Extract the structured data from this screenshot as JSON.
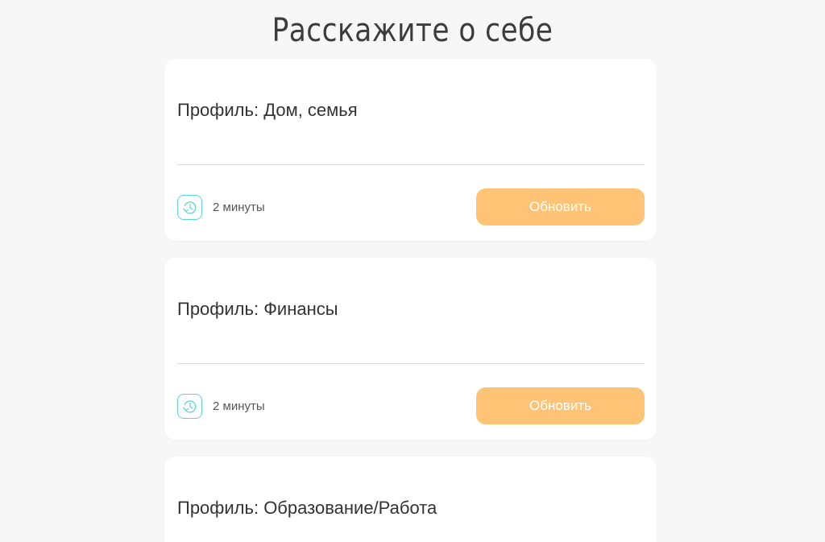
{
  "page": {
    "title": "Расскажите о себе"
  },
  "cards": [
    {
      "title": "Профиль: Дом, семья",
      "duration": "2 минуты",
      "button_label": "Обновить"
    },
    {
      "title": "Профиль: Финансы",
      "duration": "2 минуты",
      "button_label": "Обновить"
    },
    {
      "title": "Профиль: Образование/Работа"
    }
  ],
  "colors": {
    "background": "#f7f7f7",
    "card": "#ffffff",
    "button": "#ffc375",
    "icon_accent": "#5fd3df",
    "text": "#333333"
  },
  "icons": {
    "duration_icon": "clock-history-icon"
  }
}
